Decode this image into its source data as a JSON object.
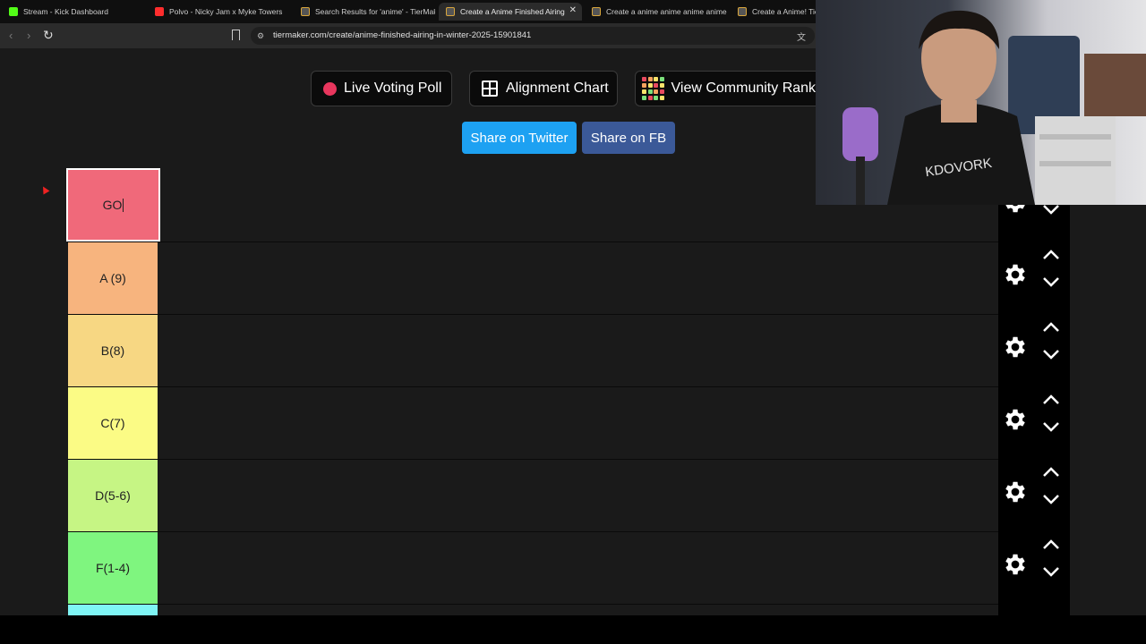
{
  "browser": {
    "tabs": [
      {
        "title": "Stream - Kick Dashboard",
        "favicon": "kick-icon"
      },
      {
        "title": "Polvo - Nicky Jam x Myke Towers",
        "favicon": "youtube-icon"
      },
      {
        "title": "Search Results for 'anime' - TierMaker",
        "favicon": "tiermaker-icon"
      },
      {
        "title": "Create a Anime Finished Airing",
        "favicon": "tiermaker-icon",
        "active": true
      },
      {
        "title": "Create a anime anime anime anime",
        "favicon": "tiermaker-icon"
      },
      {
        "title": "Create a Anime! Tier",
        "favicon": "tiermaker-icon"
      }
    ],
    "close_glyph": "✕",
    "url": "tiermaker.com/create/anime-finished-airing-in-winter-2025-15901841"
  },
  "toolbar": {
    "live_poll": "Live Voting Poll",
    "alignment": "Alignment Chart",
    "community": "View Community Rank",
    "share_twitter": "Share on Twitter",
    "share_fb": "Share on FB"
  },
  "tiers": [
    {
      "label": "GO",
      "color": "#f0697a",
      "editing": true
    },
    {
      "label": "A (9)",
      "color": "#f7b47e"
    },
    {
      "label": "B(8)",
      "color": "#f7d783"
    },
    {
      "label": "C(7)",
      "color": "#fbfb85"
    },
    {
      "label": "D(5-6)",
      "color": "#c6f584"
    },
    {
      "label": "F(1-4)",
      "color": "#7ff57f"
    },
    {
      "label": "",
      "color": "#7ff5f5"
    }
  ],
  "colors": {
    "page_bg": "#1a1a1a",
    "twitter": "#1da1f2",
    "facebook": "#3b5998",
    "live_dot": "#e8365d"
  },
  "webcam": {
    "shirt_text": "KDOVORK"
  }
}
